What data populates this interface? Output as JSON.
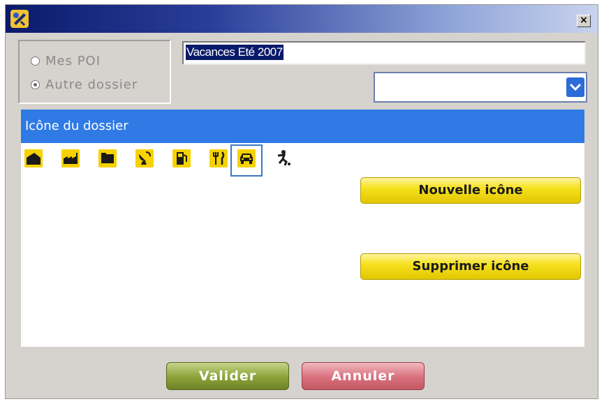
{
  "titlebar": {
    "close_symbol": "×",
    "app_icon": "satellite-icon"
  },
  "location": {
    "options": [
      {
        "label": "Mes POI",
        "checked": false
      },
      {
        "label": "Autre dossier",
        "checked": true
      }
    ]
  },
  "folder_name": {
    "value": "Vacances Eté 2007"
  },
  "folder_select": {
    "selected": ""
  },
  "icon_panel": {
    "title": "Icône du dossier",
    "icons": [
      "hangar-icon",
      "factory-icon",
      "folder-icon",
      "satellite-dish-icon",
      "fuel-pump-icon",
      "restaurant-icon",
      "car-icon",
      "running-person-icon"
    ],
    "selected_index": 6
  },
  "buttons": {
    "new_icon": "Nouvelle icône",
    "delete_icon": "Supprimer icône",
    "validate": "Valider",
    "cancel": "Annuler"
  },
  "colors": {
    "title_dark": "#0a1a6a",
    "panel_header": "#2f7ae5",
    "icon_yellow": "#f5d200",
    "validate_green": "#8ca238",
    "cancel_pink": "#d9707c"
  }
}
